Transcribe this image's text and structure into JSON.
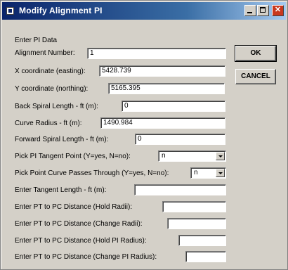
{
  "window": {
    "title": "Modify Alignment PI",
    "icon": "app-icon",
    "controls": [
      "minimize-icon",
      "maximize-icon",
      "close-icon"
    ]
  },
  "form": {
    "section_label": "Enter PI Data",
    "alignment_number": {
      "label": "Alignment Number:",
      "value": "1"
    },
    "x_coordinate": {
      "label": "X coordinate (easting):",
      "value": "5428.739"
    },
    "y_coordinate": {
      "label": "Y coordinate (northing):",
      "value": "5165.395"
    },
    "back_spiral_length": {
      "label": "Back Spiral Length - ft (m):",
      "value": "0"
    },
    "curve_radius": {
      "label": "Curve Radius - ft (m):",
      "value": "1490.984"
    },
    "forward_spiral_length": {
      "label": "Forward Spiral Length - ft (m):",
      "value": "0"
    },
    "pick_pi_tangent_point": {
      "label": "Pick PI Tangent Point (Y=yes, N=no):",
      "value": "n"
    },
    "pick_point_curve_passes": {
      "label": "Pick Point Curve Passes Through (Y=yes, N=no):",
      "value": "n"
    },
    "tangent_length": {
      "label": "Enter Tangent Length - ft (m):",
      "value": ""
    },
    "pt_pc_hold_radii": {
      "label": "Enter PT to PC Distance (Hold Radii):",
      "value": ""
    },
    "pt_pc_change_radii": {
      "label": "Enter PT to PC Distance (Change Radii):",
      "value": ""
    },
    "pt_pc_hold_pi_radius": {
      "label": "Enter PT to PC Distance (Hold PI Radius):",
      "value": ""
    },
    "pt_pc_change_pi_radius": {
      "label": "Enter PT to PC Distance (Change PI Radius):",
      "value": ""
    }
  },
  "buttons": {
    "ok": "OK",
    "cancel": "CANCEL"
  },
  "colors": {
    "title_gradient_start": "#0a246a",
    "title_gradient_end": "#a6caf0",
    "dialog_face": "#d4d0c8",
    "close_button": "#c8381e"
  }
}
